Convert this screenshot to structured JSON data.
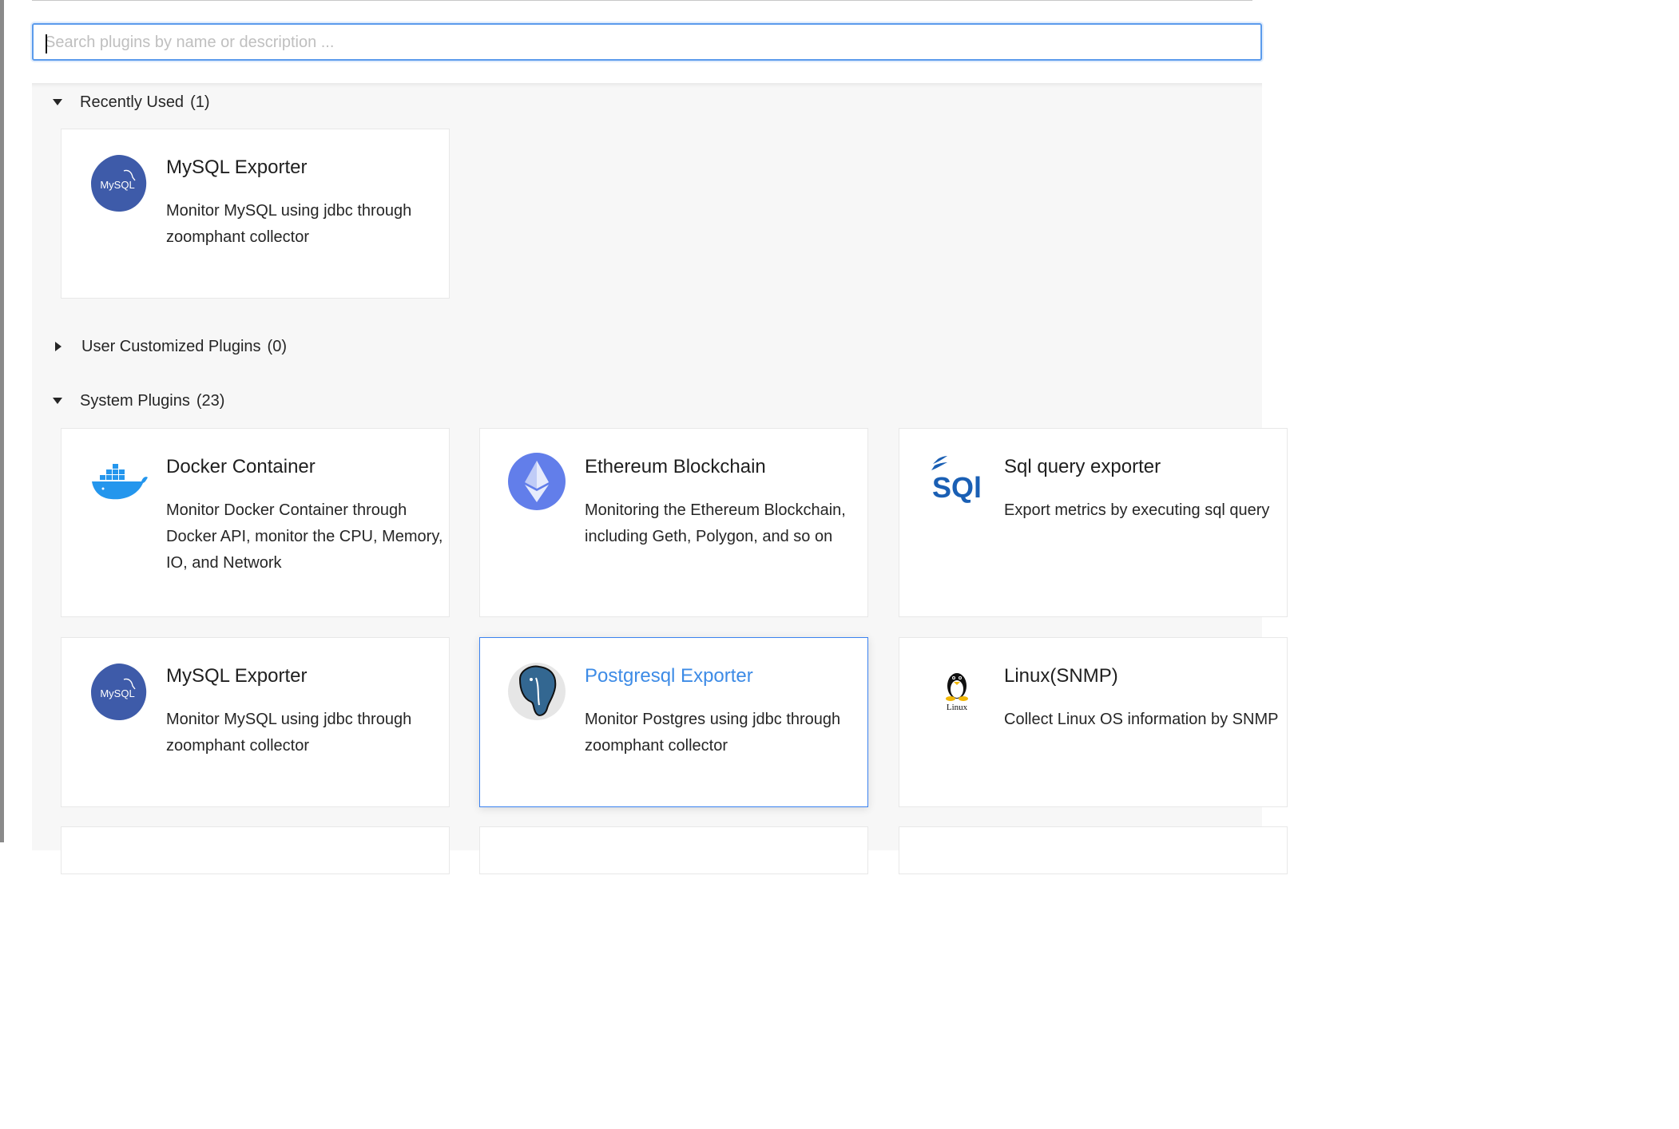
{
  "search": {
    "placeholder": "Search plugins by name or description ..."
  },
  "sections": {
    "recent": {
      "title": "Recently Used",
      "count": "(1)"
    },
    "custom": {
      "title": "User Customized Plugins",
      "count": "(0)"
    },
    "system": {
      "title": "System Plugins",
      "count": "(23)"
    }
  },
  "recent_plugins": [
    {
      "title": "MySQL Exporter",
      "desc": "Monitor MySQL using jdbc through zoomphant collector",
      "icon": "mysql-icon",
      "logo_text": "MySQL"
    }
  ],
  "system_plugins": [
    {
      "title": "Docker Container",
      "desc": "Monitor Docker Container through Docker API, monitor the CPU, Memory, IO, and Network",
      "icon": "docker-icon"
    },
    {
      "title": "Ethereum Blockchain",
      "desc": "Monitoring the Ethereum Blockchain, including Geth, Polygon, and so on",
      "icon": "ethereum-icon"
    },
    {
      "title": "Sql query exporter",
      "desc": "Export metrics by executing sql query",
      "icon": "sql-icon"
    },
    {
      "title": "MySQL Exporter",
      "desc": "Monitor MySQL using jdbc through zoomphant collector",
      "icon": "mysql-icon",
      "logo_text": "MySQL"
    },
    {
      "title": "Postgresql Exporter",
      "desc": "Monitor Postgres using jdbc through zoomphant collector",
      "icon": "postgresql-icon",
      "selected": true
    },
    {
      "title": "Linux(SNMP)",
      "desc": "Collect Linux OS information by SNMP",
      "icon": "linux-icon",
      "logo_text": "Linux"
    }
  ],
  "colors": {
    "accent": "#3d8be6",
    "mysql": "#3e5ba9",
    "docker": "#2496ed",
    "ethereum": "#627eea",
    "sql": "#1a5fb4"
  }
}
